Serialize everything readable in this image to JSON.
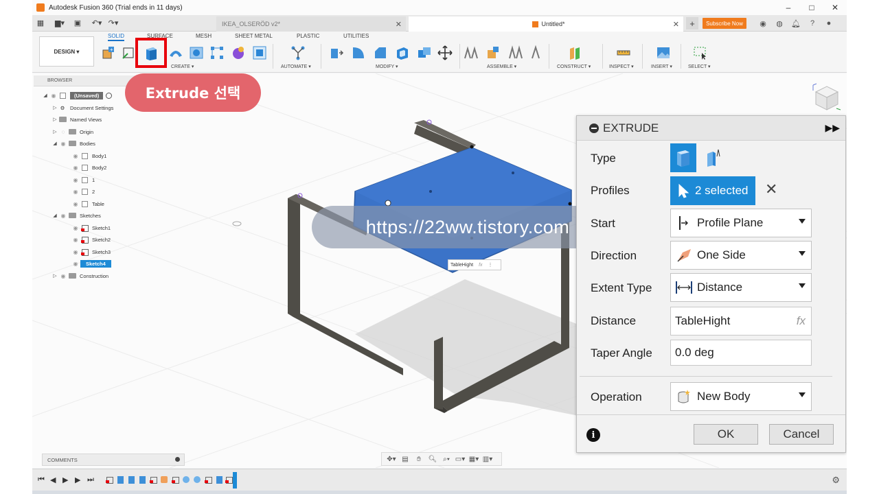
{
  "window": {
    "title": "Autodesk Fusion 360 (Trial ends in 11 days)",
    "controls": [
      "–",
      "□",
      "✕"
    ]
  },
  "tabs": {
    "doc1": "IKEA_OLSERÖD v2*",
    "doc2": "Untitled*",
    "close": "✕",
    "add": "+",
    "subscribe": "Subscribe Now"
  },
  "ribbon": {
    "workspace": "DESIGN ▾",
    "tabs": [
      "SOLID",
      "SURFACE",
      "MESH",
      "SHEET METAL",
      "PLASTIC",
      "UTILITIES"
    ],
    "groups": [
      "CREATE ▾",
      "AUTOMATE ▾",
      "MODIFY ▾",
      "ASSEMBLE ▾",
      "CONSTRUCT ▾",
      "INSPECT ▾",
      "INSERT ▾",
      "SELECT ▾"
    ]
  },
  "browser": {
    "header": "BROWSER",
    "items": [
      {
        "label": "(Unsaved)"
      },
      {
        "label": "Document Settings"
      },
      {
        "label": "Named Views"
      },
      {
        "label": "Origin"
      },
      {
        "label": "Bodies"
      },
      {
        "label": "Body1"
      },
      {
        "label": "Body2"
      },
      {
        "label": "1"
      },
      {
        "label": "2"
      },
      {
        "label": "Table"
      },
      {
        "label": "Sketches"
      },
      {
        "label": "Sketch1"
      },
      {
        "label": "Sketch2"
      },
      {
        "label": "Sketch3"
      },
      {
        "label": "Sketch4"
      },
      {
        "label": "Construction"
      }
    ]
  },
  "annotation": {
    "callout": "Extrude 선택",
    "watermark": "https://22ww.tistory.com"
  },
  "viewport": {
    "param_field": "TableHight",
    "param_fx": "fx",
    "param_menu": "⋮"
  },
  "extrude": {
    "title": "EXTRUDE",
    "expand": "▶▶",
    "type_label": "Type",
    "profiles_label": "Profiles",
    "profiles_value": "2 selected",
    "clear": "✕",
    "start_label": "Start",
    "start_value": "Profile Plane",
    "direction_label": "Direction",
    "direction_value": "One Side",
    "extent_label": "Extent Type",
    "extent_value": "Distance",
    "distance_label": "Distance",
    "distance_value": "TableHight",
    "distance_fx": "fx",
    "taper_label": "Taper Angle",
    "taper_value": "0.0 deg",
    "operation_label": "Operation",
    "operation_value": "New Body",
    "info": "i",
    "ok": "OK",
    "cancel": "Cancel"
  },
  "comments": {
    "label": "COMMENTS"
  },
  "colors": {
    "accent": "#1c8ad6",
    "highlight_red": "#e8000b",
    "callout": "#e3656c",
    "subscribe": "#f07b1d",
    "frame": "#4f4d47",
    "tabletop": "#3b73c8"
  }
}
